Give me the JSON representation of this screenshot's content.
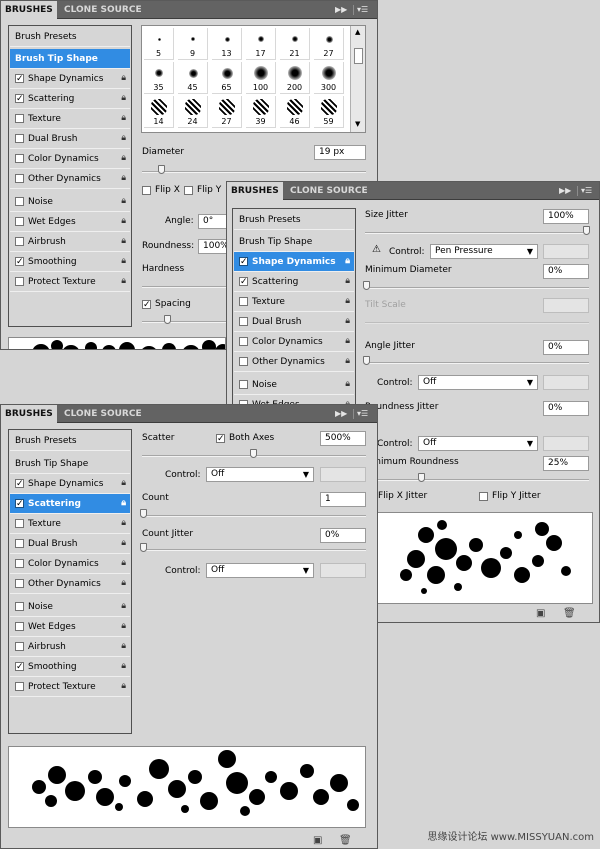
{
  "tabs": {
    "brushes": "BRUSHES",
    "clone_source": "CLONE SOURCE"
  },
  "options": {
    "brush_presets": "Brush Presets",
    "brush_tip_shape": "Brush Tip Shape",
    "shape_dynamics": "Shape Dynamics",
    "scattering": "Scattering",
    "texture": "Texture",
    "dual_brush": "Dual Brush",
    "color_dynamics": "Color Dynamics",
    "other_dynamics": "Other Dynamics",
    "noise": "Noise",
    "wet_edges": "Wet Edges",
    "airbrush": "Airbrush",
    "smoothing": "Smoothing",
    "protect_texture": "Protect Texture"
  },
  "checkmarks": {
    "checked": "✓",
    "unchecked": ""
  },
  "icons": {
    "lock": "lock-icon",
    "panel_menu": "menu-icon",
    "collapse": "double-arrow-icon",
    "new": "new-brush-icon",
    "trash": "trash-icon",
    "warning": "warning-icon"
  },
  "panel1": {
    "tip_sizes": [
      "5",
      "9",
      "13",
      "17",
      "21",
      "27",
      "35",
      "45",
      "65",
      "100",
      "200",
      "300",
      "14",
      "24",
      "27",
      "39",
      "46",
      "59"
    ],
    "diameter_label": "Diameter",
    "diameter_value": "19 px",
    "flip_x": "Flip X",
    "flip_y": "Flip Y",
    "angle_label": "Angle:",
    "angle_value": "0°",
    "roundness_label": "Roundness:",
    "roundness_value": "100%",
    "hardness_label": "Hardness",
    "spacing_label": "Spacing"
  },
  "panel2": {
    "size_jitter_label": "Size Jitter",
    "size_jitter_value": "100%",
    "control_label": "Control:",
    "size_control": "Pen Pressure",
    "min_diameter_label": "Minimum Diameter",
    "min_diameter_value": "0%",
    "tilt_scale_label": "Tilt Scale",
    "angle_jitter_label": "Angle Jitter",
    "angle_jitter_value": "0%",
    "angle_control": "Off",
    "roundness_jitter_label": "Roundness Jitter",
    "roundness_jitter_value": "0%",
    "roundness_control": "Off",
    "min_roundness_label": "Minimum Roundness",
    "min_roundness_value": "25%",
    "flip_x_jitter": "Flip X Jitter",
    "flip_y_jitter": "Flip Y Jitter"
  },
  "panel3": {
    "scatter_label": "Scatter",
    "both_axes": "Both Axes",
    "scatter_value": "500%",
    "control_label": "Control:",
    "scatter_control": "Off",
    "count_label": "Count",
    "count_value": "1",
    "count_jitter_label": "Count Jitter",
    "count_jitter_value": "0%",
    "count_jitter_control": "Off"
  },
  "watermark": "思缘设计论坛 www.MISSYUAN.com",
  "colors": {
    "selected": "#318ce3",
    "panel": "#d6d6d6",
    "tabbar": "#636363"
  }
}
